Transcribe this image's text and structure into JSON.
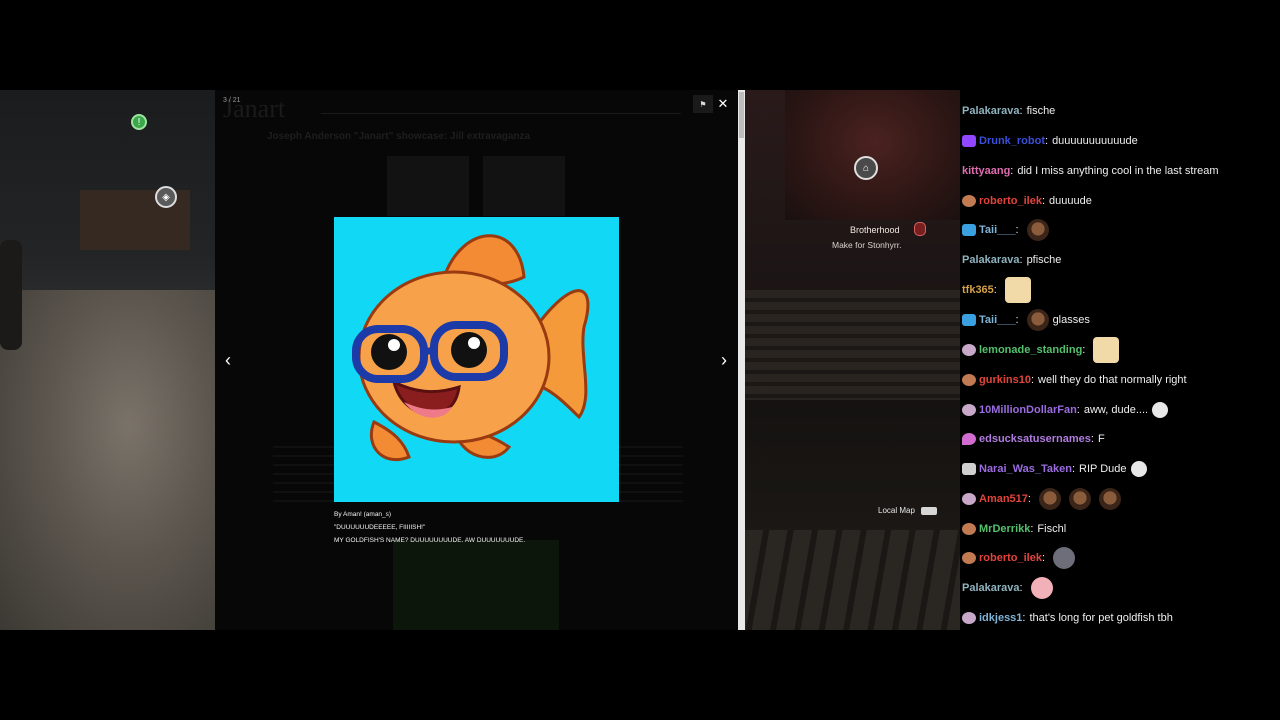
{
  "popup": {
    "counter": "3 / 21",
    "ghost_title": "Janart",
    "ghost_subtitle": "Joseph Anderson \"Janart\" showcase: Jill extravaganza",
    "close_icon": "close-icon",
    "flag_icon": "flag-icon",
    "prev_icon": "chevron-left-icon",
    "next_icon": "chevron-right-icon",
    "artwork_subject": "goldfish-with-glasses",
    "caption": {
      "credit": "By Aman! (aman_s)",
      "quote": "\"DUUUUUUDEEEEE, FIIIIISH!\"",
      "body": "MY GOLDFISH'S NAME? DUUUUUUUUDE. AW DUUUUUUUDE."
    }
  },
  "game_right": {
    "quest_title": "Brotherhood",
    "quest_subtitle": "Make for Stonhyrr.",
    "local_map_label": "Local Map"
  },
  "chat": {
    "messages": [
      {
        "badge": "none",
        "name": "Palakarava",
        "color": "#8fb3bf",
        "text": "fische"
      },
      {
        "badge": "prime",
        "name": "Drunk_robot",
        "color": "#3c4fd8",
        "text": "duuuuuuuuuuude"
      },
      {
        "badge": "none",
        "name": "kittyaang",
        "color": "#e06cb0",
        "text": "did I miss anything cool in the last stream"
      },
      {
        "badge": "sub",
        "name": "roberto_ilek",
        "color": "#e0453c",
        "text": "duuuude"
      },
      {
        "badge": "crown",
        "name": "Taii___",
        "color": "#7fb3d8",
        "text": "",
        "emotes": [
          "face"
        ]
      },
      {
        "badge": "none",
        "name": "Palakarava",
        "color": "#8fb3bf",
        "text": "pfische"
      },
      {
        "badge": "none",
        "name": "tfk365",
        "color": "#d4a24a",
        "text": "",
        "emotes": [
          "anime"
        ]
      },
      {
        "badge": "crown",
        "name": "Taii___",
        "color": "#7fb3d8",
        "text": "glasses",
        "emotes_before": [
          "face"
        ]
      },
      {
        "badge": "wolf",
        "name": "lemonade_standing",
        "color": "#54c06c",
        "text": "",
        "emotes": [
          "anime"
        ]
      },
      {
        "badge": "sub",
        "name": "gurkins10",
        "color": "#e0453c",
        "text": "well they do that normally right"
      },
      {
        "badge": "wolf",
        "name": "10MillionDollarFan",
        "color": "#9b6ce0",
        "text": "aww, dude....",
        "emotes": [
          "ghost"
        ]
      },
      {
        "badge": "drop",
        "name": "edsucksatusernames",
        "color": "#b07ce0",
        "text": "F"
      },
      {
        "badge": "mute",
        "name": "Narai_Was_Taken",
        "color": "#9b6ce0",
        "text": "RIP Dude",
        "emotes": [
          "ghost"
        ]
      },
      {
        "badge": "wolf",
        "name": "Aman517",
        "color": "#e0453c",
        "text": "",
        "emotes": [
          "face",
          "face",
          "face"
        ]
      },
      {
        "badge": "sub",
        "name": "MrDerrikk",
        "color": "#54c06c",
        "text": "Fischl"
      },
      {
        "badge": "sub",
        "name": "roberto_ilek",
        "color": "#e0453c",
        "text": "",
        "emotes": [
          "girl"
        ]
      },
      {
        "badge": "none",
        "name": "Palakarava",
        "color": "#8fb3bf",
        "text": "",
        "emotes": [
          "fishpink"
        ]
      },
      {
        "badge": "wolf",
        "name": "idkjess1",
        "color": "#7fb3d8",
        "text": "that's long for pet goldfish tbh"
      }
    ]
  }
}
